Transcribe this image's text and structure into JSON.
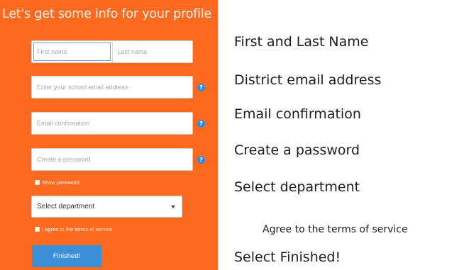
{
  "form": {
    "title": "Let's get some info for your profile",
    "first_name_placeholder": "First name",
    "last_name_placeholder": "Last name",
    "email_placeholder": "Enter your school email address",
    "email_confirm_placeholder": "Email confirmation",
    "password_placeholder": "Create a password",
    "show_password_label": "Show password",
    "department_selected": "Select department",
    "terms_label": "I agree to the terms of service",
    "finish_label": "Finished!",
    "help_glyph": "?"
  },
  "instructions": {
    "name": "First and Last Name",
    "email": "District email address",
    "email_confirm": "Email confirmation",
    "password": "Create a password",
    "department": "Select department",
    "terms": "Agree to the terms of service",
    "finish": "Select Finished!"
  },
  "colors": {
    "panel_background": "#fb6a1f",
    "button_background": "#3b8fd6",
    "help_icon": "#2a8ee0"
  },
  "icons": {
    "help": "question-circle-icon",
    "dropdown": "caret-down-icon",
    "checkbox": "checkbox-icon"
  }
}
